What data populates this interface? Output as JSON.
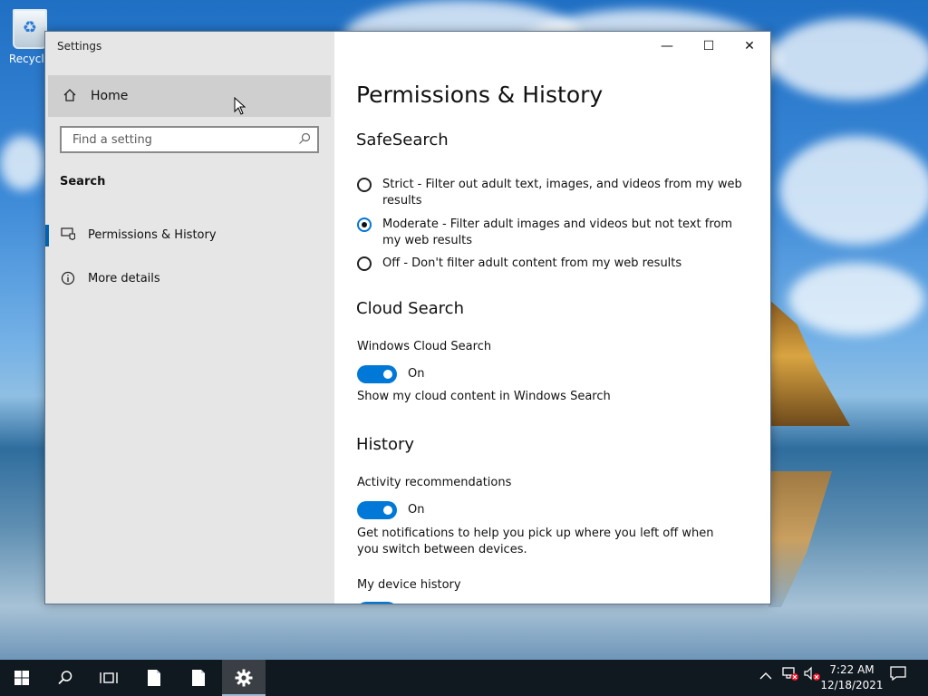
{
  "desktop": {
    "recycle_bin_label": "Recycle"
  },
  "window": {
    "title": "Settings",
    "controls": {
      "minimize": "—",
      "maximize": "☐",
      "close": "✕"
    }
  },
  "sidebar": {
    "home_label": "Home",
    "search_placeholder": "Find a setting",
    "section_label": "Search",
    "items": [
      {
        "label": "Permissions & History",
        "icon": "permissions-icon",
        "selected": true
      },
      {
        "label": "More details",
        "icon": "info-icon",
        "selected": false
      }
    ]
  },
  "content": {
    "page_title": "Permissions & History",
    "safesearch": {
      "heading": "SafeSearch",
      "options": [
        {
          "label": "Strict - Filter out adult text, images, and videos from my web results",
          "selected": false
        },
        {
          "label": "Moderate - Filter adult images and videos but not text from my web results",
          "selected": true
        },
        {
          "label": "Off - Don't filter adult content from my web results",
          "selected": false
        }
      ]
    },
    "cloud_search": {
      "heading": "Cloud Search",
      "setting_label": "Windows Cloud Search",
      "toggle_state": "On",
      "description": "Show my cloud content in Windows Search"
    },
    "history": {
      "heading": "History",
      "activity_label": "Activity recommendations",
      "activity_toggle_state": "On",
      "activity_description": "Get notifications to help you pick up where you left off when you switch between devices.",
      "device_history_label": "My device history"
    }
  },
  "taskbar": {
    "time": "7:22 AM",
    "date": "12/18/2021",
    "accent": "#0078d7"
  }
}
